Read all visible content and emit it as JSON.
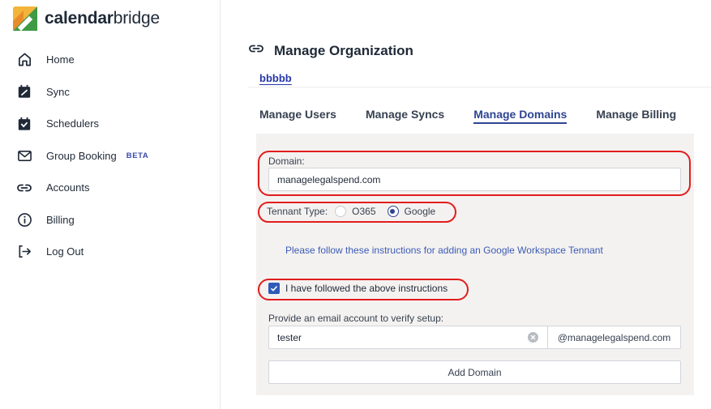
{
  "brand": {
    "name_bold": "calendar",
    "name_light": "bridge"
  },
  "sidebar": {
    "items": [
      {
        "label": "Home",
        "icon": "home-icon"
      },
      {
        "label": "Sync",
        "icon": "sync-calendar-icon"
      },
      {
        "label": "Schedulers",
        "icon": "scheduler-calendar-icon"
      },
      {
        "label": "Group Booking",
        "icon": "envelope-icon",
        "badge": "BETA"
      },
      {
        "label": "Accounts",
        "icon": "link-icon"
      },
      {
        "label": "Billing",
        "icon": "info-icon"
      },
      {
        "label": "Log Out",
        "icon": "logout-icon"
      }
    ]
  },
  "page": {
    "title": "Manage Organization",
    "org_name": "bbbbb"
  },
  "tabs": [
    {
      "label": "Manage Users",
      "active": false
    },
    {
      "label": "Manage Syncs",
      "active": false
    },
    {
      "label": "Manage Domains",
      "active": true
    },
    {
      "label": "Manage Billing",
      "active": false
    }
  ],
  "form": {
    "domain_label": "Domain:",
    "domain_value": "managelegalspend.com",
    "tenant_label": "Tennant Type:",
    "tenant_options": [
      {
        "label": "O365",
        "selected": false
      },
      {
        "label": "Google",
        "selected": true
      }
    ],
    "instructions_link": "Please follow these instructions for adding an Google Workspace Tennant",
    "checkbox_label": "I have followed the above instructions",
    "checkbox_checked": true,
    "verify_label": "Provide an email account to verify setup:",
    "email_value": "tester",
    "email_suffix": "@managelegalspend.com",
    "add_button": "Add Domain"
  },
  "colors": {
    "accent": "#2f4592",
    "link": "#3b5bb5",
    "highlight": "#e11d1d",
    "panel": "#f4f2f0"
  }
}
